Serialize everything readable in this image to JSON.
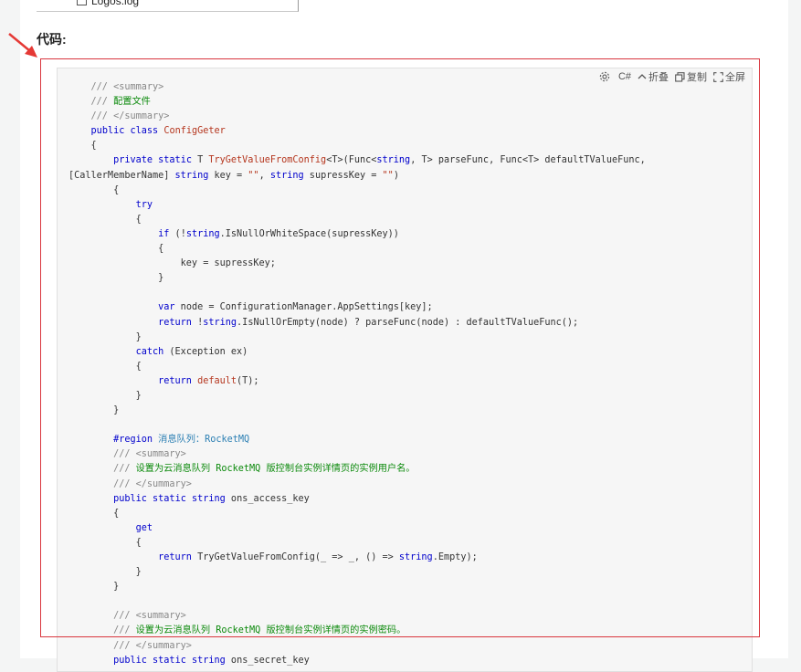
{
  "tree": {
    "visible_text": "Logos.log",
    "icon": "file-icon"
  },
  "heading": "代码:",
  "toolbar": {
    "language": "C#",
    "collapse_label": "折叠",
    "copy_label": "复制",
    "fullscreen_label": "全屏"
  },
  "colors": {
    "keyword": "#0000cc",
    "function": "#b5361e",
    "comment": "#888888",
    "comment_text": "#0c8a0c",
    "region": "#2b7fb3",
    "highlight": "#d9363e"
  },
  "code_lines": [
    [
      [
        "    /// <summary>",
        "cm"
      ]
    ],
    [
      [
        "    /// ",
        "cm"
      ],
      [
        "配置文件",
        "zh"
      ]
    ],
    [
      [
        "    /// </summary>",
        "cm"
      ]
    ],
    [
      [
        "    ",
        ""
      ],
      [
        "public",
        "kw"
      ],
      [
        " ",
        ""
      ],
      [
        "class",
        "kw"
      ],
      [
        " ",
        ""
      ],
      [
        "ConfigGeter",
        "fn"
      ]
    ],
    [
      [
        "    {",
        ""
      ]
    ],
    [
      [
        "        ",
        ""
      ],
      [
        "private",
        "kw"
      ],
      [
        " ",
        ""
      ],
      [
        "static",
        "kw"
      ],
      [
        " T ",
        ""
      ],
      [
        "TryGetValueFromConfig",
        "fn"
      ],
      [
        "<T>(Func<",
        ""
      ],
      [
        "string",
        "kw"
      ],
      [
        ", T> parseFunc, Func<T> defaultTValueFunc,",
        ""
      ]
    ],
    [
      [
        "[CallerMemberName] ",
        ""
      ],
      [
        "string",
        "kw"
      ],
      [
        " key = ",
        ""
      ],
      [
        "\"\"",
        "fn"
      ],
      [
        ", ",
        ""
      ],
      [
        "string",
        "kw"
      ],
      [
        " supressKey = ",
        ""
      ],
      [
        "\"\"",
        "fn"
      ],
      [
        ")",
        ""
      ]
    ],
    [
      [
        "        {",
        ""
      ]
    ],
    [
      [
        "            ",
        ""
      ],
      [
        "try",
        "kw"
      ]
    ],
    [
      [
        "            {",
        ""
      ]
    ],
    [
      [
        "                ",
        ""
      ],
      [
        "if",
        "kw"
      ],
      [
        " (!",
        ""
      ],
      [
        "string",
        "kw"
      ],
      [
        ".IsNullOrWhiteSpace(supressKey))",
        ""
      ]
    ],
    [
      [
        "                {",
        ""
      ]
    ],
    [
      [
        "                    key = supressKey;",
        ""
      ]
    ],
    [
      [
        "                }",
        ""
      ]
    ],
    [
      [
        "",
        ""
      ]
    ],
    [
      [
        "                ",
        ""
      ],
      [
        "var",
        "kw"
      ],
      [
        " node = ConfigurationManager.AppSettings[key];",
        ""
      ]
    ],
    [
      [
        "                ",
        ""
      ],
      [
        "return",
        "kw"
      ],
      [
        " !",
        ""
      ],
      [
        "string",
        "kw"
      ],
      [
        ".IsNullOrEmpty(node) ? parseFunc(node) : defaultTValueFunc();",
        ""
      ]
    ],
    [
      [
        "            }",
        ""
      ]
    ],
    [
      [
        "            ",
        ""
      ],
      [
        "catch",
        "kw"
      ],
      [
        " (Exception ex)",
        ""
      ]
    ],
    [
      [
        "            {",
        ""
      ]
    ],
    [
      [
        "                ",
        ""
      ],
      [
        "return",
        "kw"
      ],
      [
        " ",
        ""
      ],
      [
        "default",
        "fn"
      ],
      [
        "(T);",
        ""
      ]
    ],
    [
      [
        "            }",
        ""
      ]
    ],
    [
      [
        "        }",
        ""
      ]
    ],
    [
      [
        "",
        ""
      ]
    ],
    [
      [
        "        ",
        ""
      ],
      [
        "#region",
        "kw"
      ],
      [
        " ",
        ""
      ],
      [
        "消息队列：RocketMQ",
        "rg"
      ]
    ],
    [
      [
        "        /// <summary>",
        "cm"
      ]
    ],
    [
      [
        "        /// ",
        "cm"
      ],
      [
        "设置为云消息队列 RocketMQ 版控制台实例详情页的实例用户名。",
        "zh"
      ]
    ],
    [
      [
        "        /// </summary>",
        "cm"
      ]
    ],
    [
      [
        "        ",
        ""
      ],
      [
        "public",
        "kw"
      ],
      [
        " ",
        ""
      ],
      [
        "static",
        "kw"
      ],
      [
        " ",
        ""
      ],
      [
        "string",
        "kw"
      ],
      [
        " ons_access_key",
        ""
      ]
    ],
    [
      [
        "        {",
        ""
      ]
    ],
    [
      [
        "            ",
        ""
      ],
      [
        "get",
        "kw"
      ]
    ],
    [
      [
        "            {",
        ""
      ]
    ],
    [
      [
        "                ",
        ""
      ],
      [
        "return",
        "kw"
      ],
      [
        " TryGetValueFromConfig(_ => _, () => ",
        ""
      ],
      [
        "string",
        "kw"
      ],
      [
        ".Empty);",
        ""
      ]
    ],
    [
      [
        "            }",
        ""
      ]
    ],
    [
      [
        "        }",
        ""
      ]
    ],
    [
      [
        "",
        ""
      ]
    ],
    [
      [
        "        /// <summary>",
        "cm"
      ]
    ],
    [
      [
        "        /// ",
        "cm"
      ],
      [
        "设置为云消息队列 RocketMQ 版控制台实例详情页的实例密码。",
        "zh"
      ]
    ],
    [
      [
        "        /// </summary>",
        "cm"
      ]
    ],
    [
      [
        "        ",
        ""
      ],
      [
        "public",
        "kw"
      ],
      [
        " ",
        ""
      ],
      [
        "static",
        "kw"
      ],
      [
        " ",
        ""
      ],
      [
        "string",
        "kw"
      ],
      [
        " ons_secret_key",
        ""
      ]
    ]
  ]
}
